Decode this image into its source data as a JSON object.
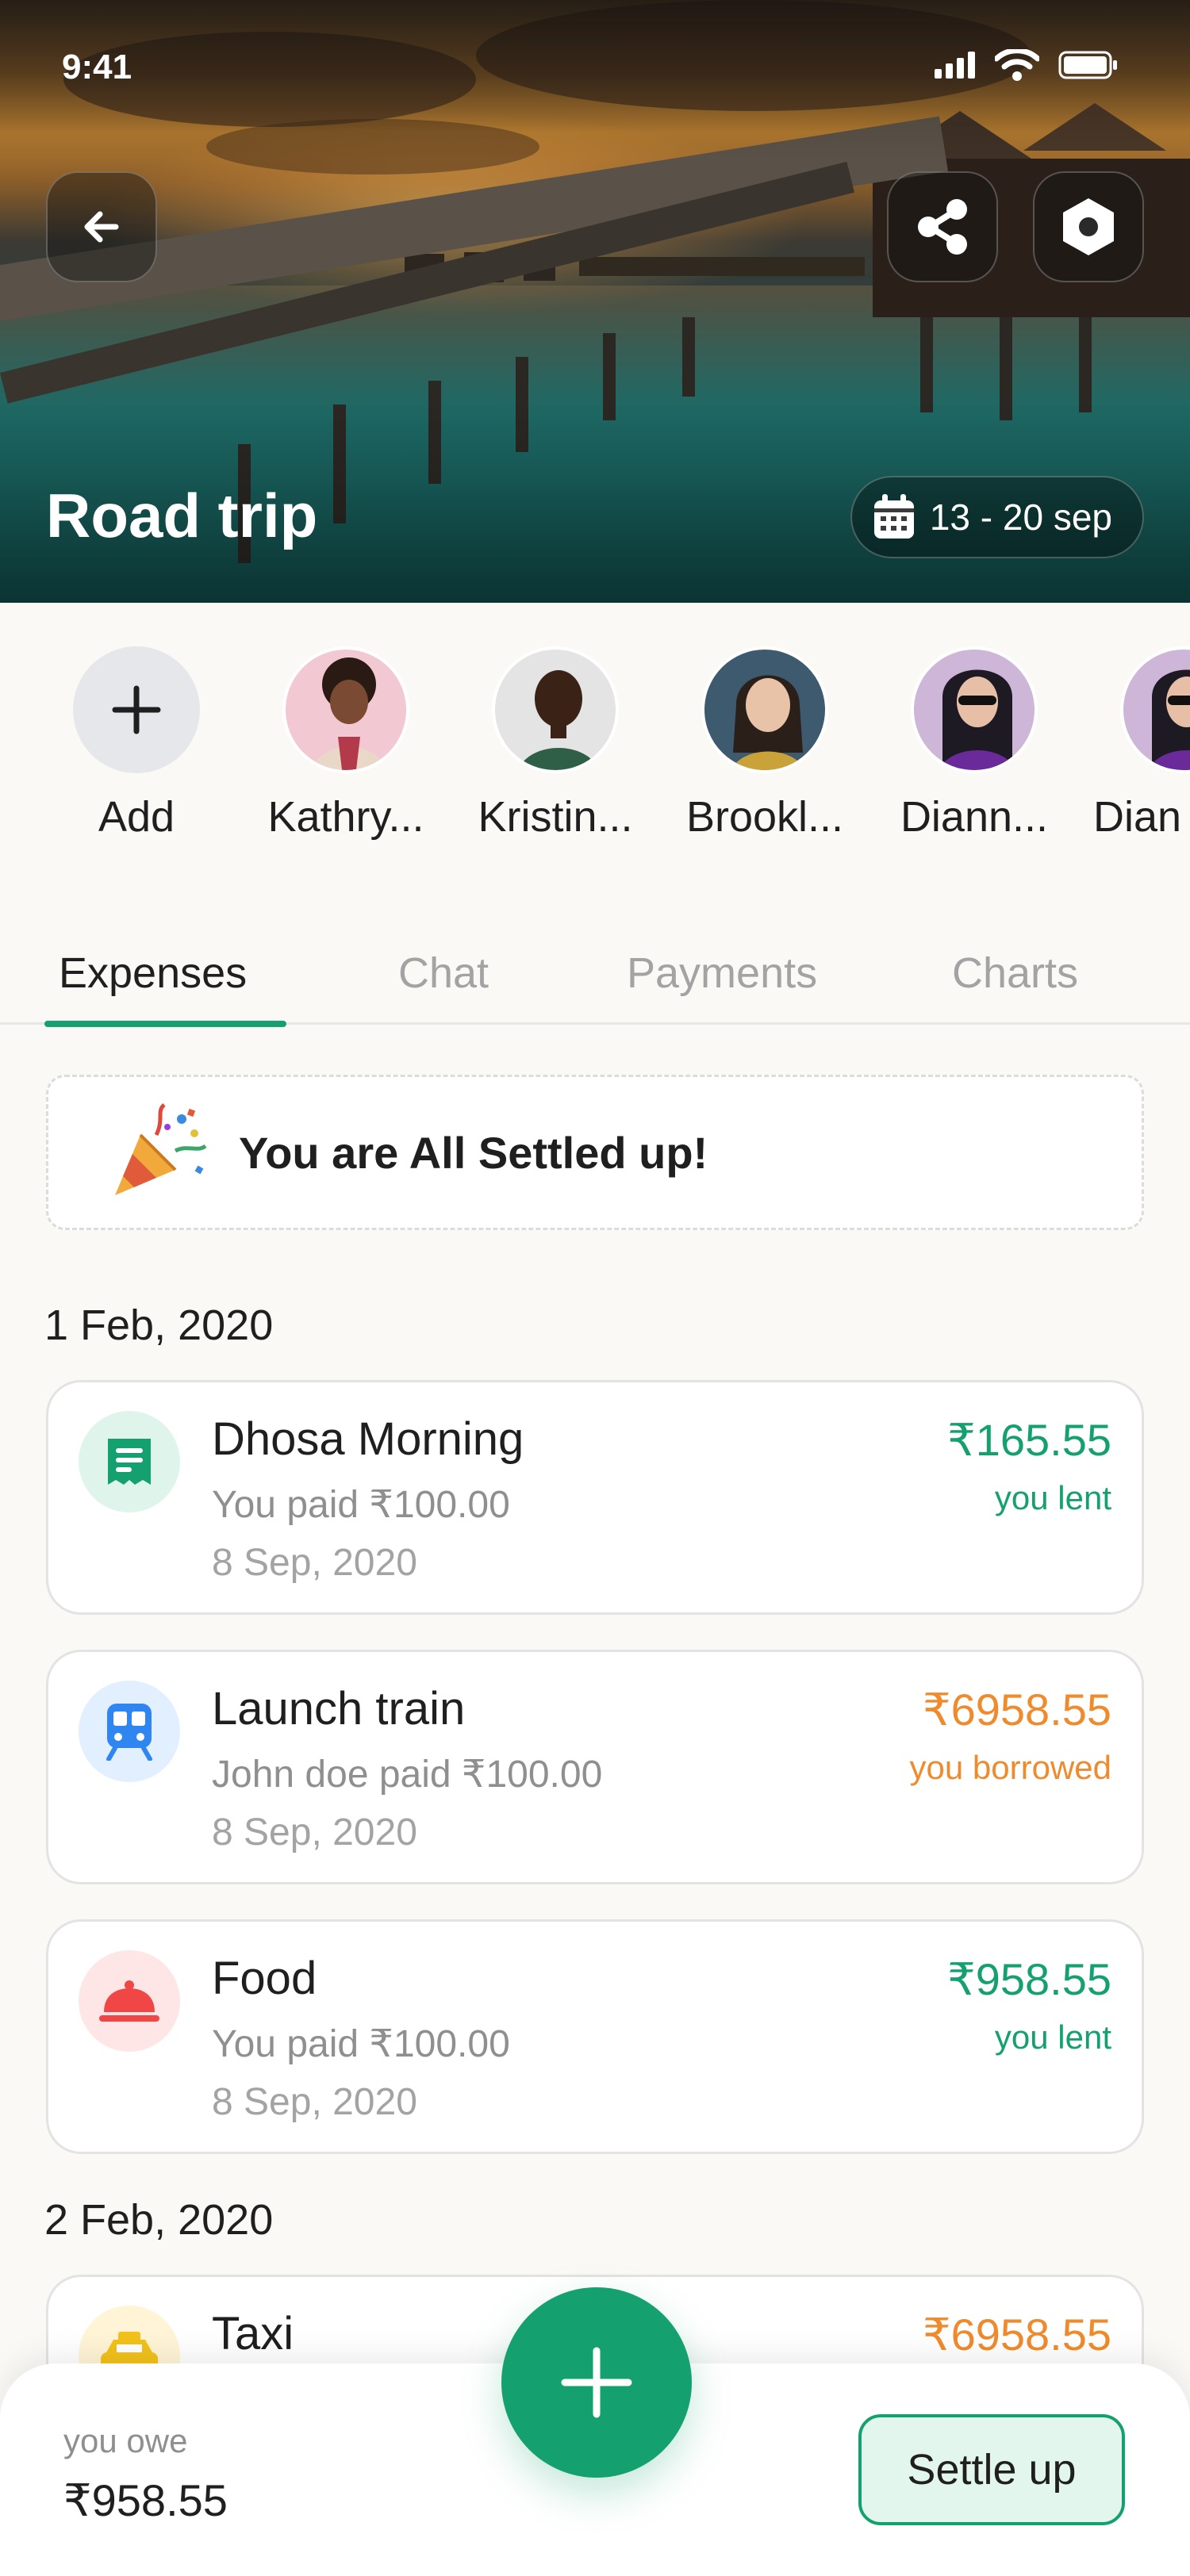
{
  "status_bar": {
    "time": "9:41"
  },
  "header": {
    "title": "Road trip",
    "date_range": "13 - 20 sep",
    "icons": {
      "back": "arrow-left-icon",
      "share": "share-icon",
      "settings": "settings-hexagon-icon",
      "calendar": "calendar-icon"
    }
  },
  "members": {
    "add_label": "Add",
    "items": [
      {
        "name": "Kathry..."
      },
      {
        "name": "Kristin..."
      },
      {
        "name": "Brookl..."
      },
      {
        "name": "Diann..."
      },
      {
        "name": "Dian"
      }
    ]
  },
  "tabs": [
    {
      "label": "Expenses",
      "active": true
    },
    {
      "label": "Chat",
      "active": false
    },
    {
      "label": "Payments",
      "active": false
    },
    {
      "label": "Charts",
      "active": false
    }
  ],
  "settled_banner": {
    "text": "You are All Settled up!",
    "icon": "party-popper-icon"
  },
  "groups": [
    {
      "date": "1 Feb, 2020",
      "expenses": [
        {
          "title": "Dhosa Morning",
          "subtitle": "You paid ₹100.00",
          "date": "8 Sep, 2020",
          "amount": "₹165.55",
          "note": "you lent",
          "status": "lent",
          "icon": "receipt-icon"
        },
        {
          "title": "Launch train",
          "subtitle": "John doe paid ₹100.00",
          "date": "8 Sep, 2020",
          "amount": "₹6958.55",
          "note": "you borrowed",
          "status": "borrowed",
          "icon": "train-icon"
        },
        {
          "title": "Food",
          "subtitle": "You paid ₹100.00",
          "date": "8 Sep, 2020",
          "amount": "₹958.55",
          "note": "you lent",
          "status": "lent",
          "icon": "food-cloche-icon"
        }
      ]
    },
    {
      "date": "2 Feb, 2020",
      "expenses": [
        {
          "title": "Taxi",
          "amount": "₹6958.55",
          "status": "borrowed",
          "icon": "taxi-icon"
        }
      ]
    }
  ],
  "footer": {
    "owe_label": "you owe",
    "owe_amount": "₹958.55",
    "settle_label": "Settle up",
    "fab_icon": "plus-icon"
  },
  "colors": {
    "accent": "#15a06f",
    "borrowed": "#ef8b2c",
    "lent": "#15a06f"
  }
}
